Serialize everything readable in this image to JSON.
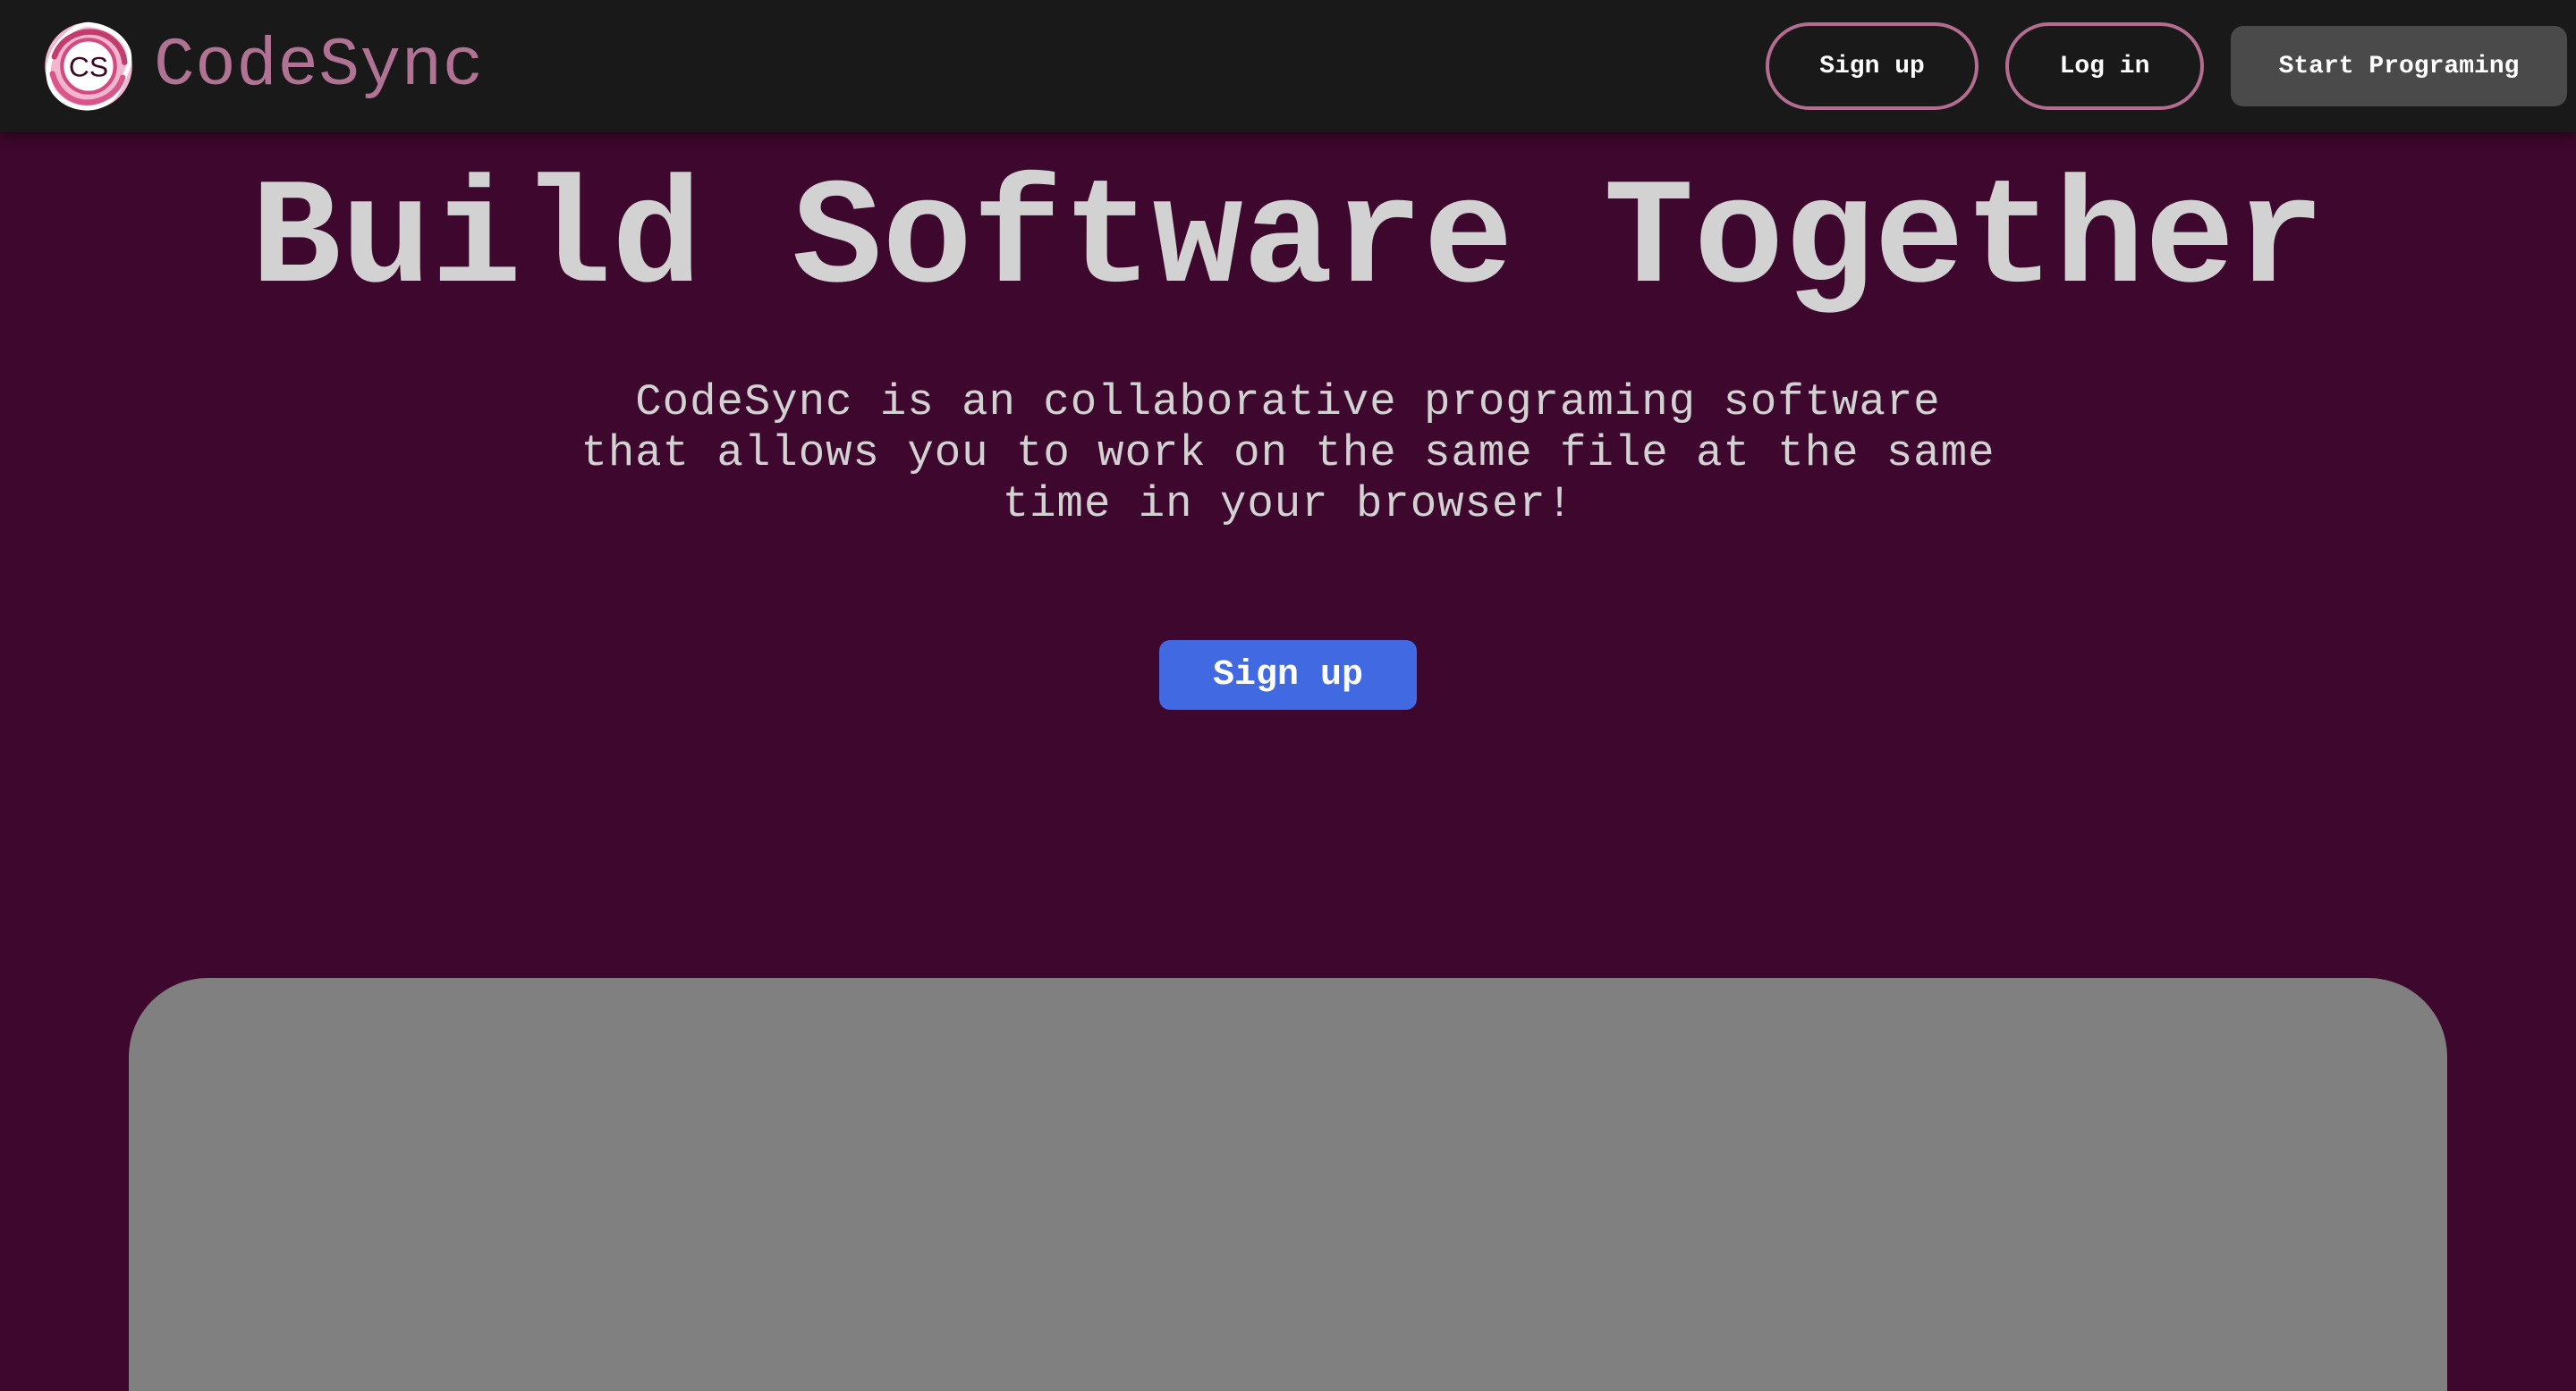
{
  "navbar": {
    "brand": {
      "logo_icon": "codesync-logo-icon",
      "logo_text": "CS",
      "name": "CodeSync"
    },
    "signup_label": "Sign up",
    "login_label": "Log in",
    "start_label": "Start Programing"
  },
  "hero": {
    "title": "Build Software Together",
    "description": "CodeSync is an collaborative programing software that allows you to work on the same file at the same time in your browser!",
    "signup_label": "Sign up"
  },
  "colors": {
    "background": "#3e072d",
    "navbar": "#191919",
    "brand": "#b07393",
    "button_outline": "#b56c91",
    "start_button": "#4a4a4a",
    "primary_button": "#4169e1",
    "preview_panel": "#808080",
    "text": "#d2d2d2"
  }
}
